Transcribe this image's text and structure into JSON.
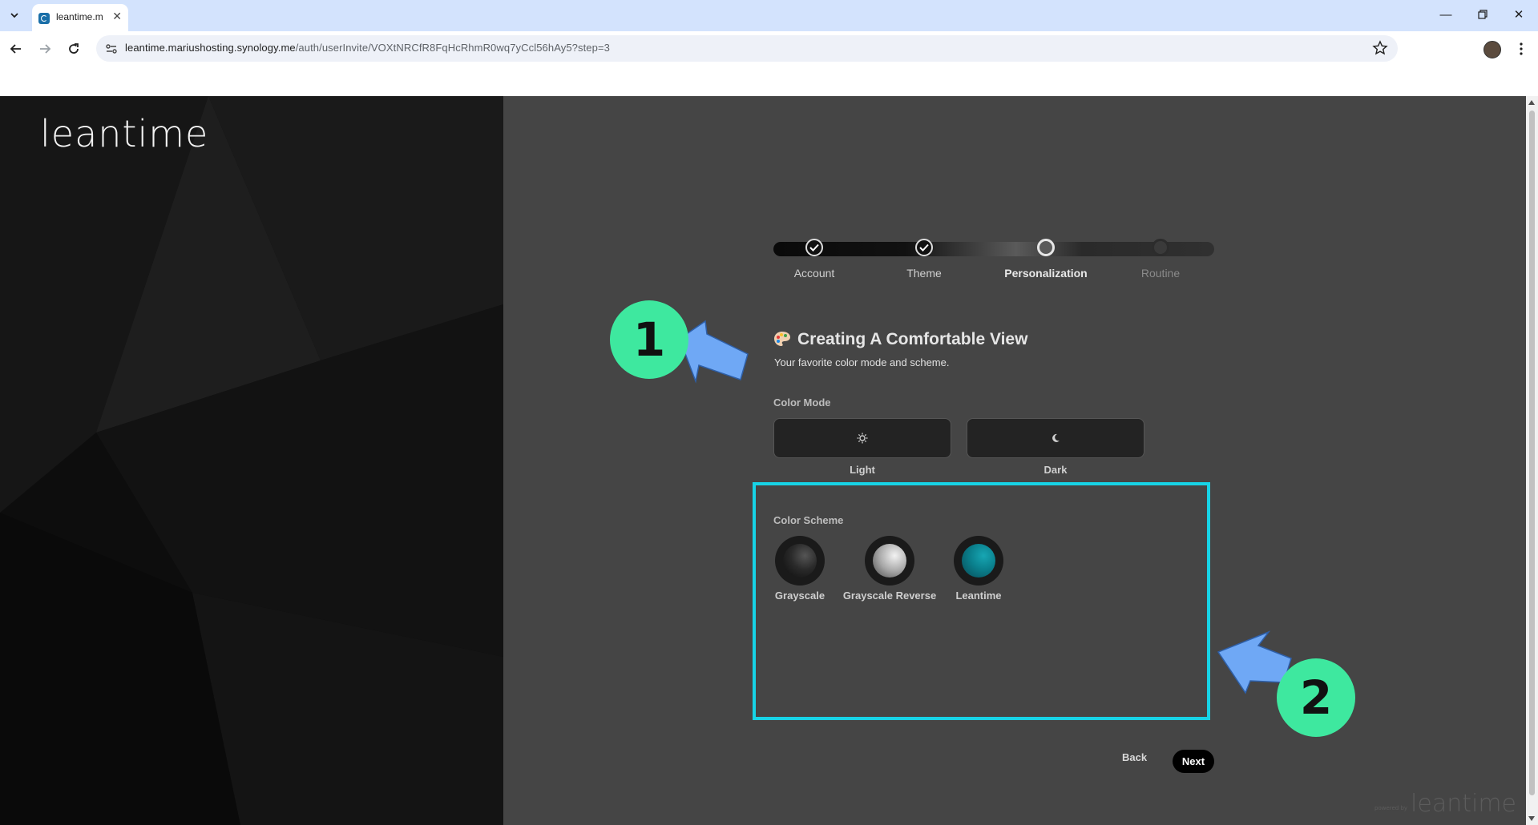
{
  "browser": {
    "tab_title": "leantime.m",
    "url_host": "leantime.mariushosting.synology.me",
    "url_path": "/auth/userInvite/VOXtNRCfR8FqHcRhmR0wq7yCcl56hAy5?step=3"
  },
  "brand": {
    "logo_text": "leantime"
  },
  "stepper": {
    "steps": [
      {
        "label": "Account",
        "state": "done"
      },
      {
        "label": "Theme",
        "state": "done"
      },
      {
        "label": "Personalization",
        "state": "current"
      },
      {
        "label": "Routine",
        "state": "todo"
      }
    ]
  },
  "content": {
    "title": "Creating A Comfortable View",
    "subtitle": "Your favorite color mode and scheme.",
    "color_mode": {
      "label": "Color Mode",
      "options": [
        {
          "label": "Light",
          "icon": "sun-icon"
        },
        {
          "label": "Dark",
          "icon": "moon-icon"
        }
      ]
    },
    "color_scheme": {
      "label": "Color Scheme",
      "options": [
        {
          "label": "Grayscale",
          "color": "#2a2a2a"
        },
        {
          "label": "Grayscale Reverse",
          "color": "#a8a8a8"
        },
        {
          "label": "Leantime",
          "color": "#0a7f8c"
        }
      ]
    }
  },
  "actions": {
    "back_label": "Back",
    "next_label": "Next"
  },
  "annotations": {
    "callout_1": "1",
    "callout_2": "2",
    "highlight_color": "#17d3e6",
    "callout_color": "#3ee89f",
    "arrow_color": "#6fa8f5"
  },
  "footer": {
    "powered_by": "powered by",
    "watermark": "leantime"
  }
}
